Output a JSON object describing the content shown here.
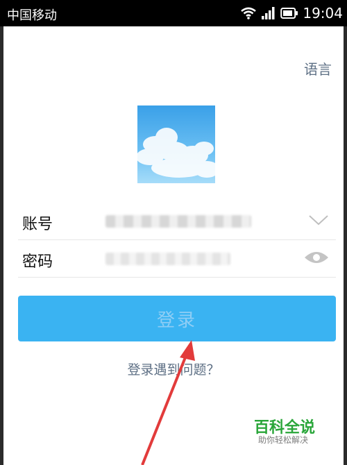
{
  "status_bar": {
    "carrier": "中国移动",
    "time": "19:04",
    "icons": [
      "wifi-icon",
      "signal-icon",
      "battery-icon"
    ]
  },
  "header": {
    "language_label": "语言"
  },
  "form": {
    "account_label": "账号",
    "password_label": "密码",
    "dropdown_icon": "chevron-down-icon",
    "password_visibility_icon": "eye-icon"
  },
  "actions": {
    "login_label": "登录",
    "help_link": "登录遇到问题？"
  },
  "watermark": {
    "title": "百科全说",
    "subtitle": "助你轻松解决"
  },
  "colors": {
    "status_bar": "#000000",
    "primary_button": "#3ab3f2",
    "button_text": "#8fcef5",
    "link_text": "#5d6f84",
    "annotation_arrow": "#e23b3b",
    "watermark_green": "#2aa63a"
  }
}
